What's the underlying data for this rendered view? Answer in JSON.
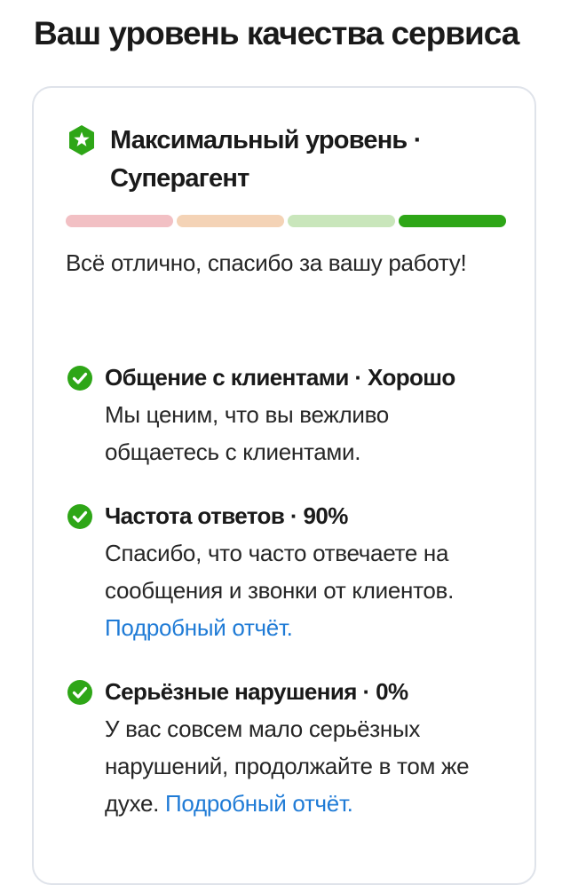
{
  "header": {
    "title": "Ваш уровень качества сервиса"
  },
  "level": {
    "icon": "star-badge-icon",
    "title": "Максимальный уровень · Суперагент",
    "current_step": 4,
    "total_steps": 4,
    "segment_colors": [
      "#f2c0c4",
      "#f4d3b6",
      "#c9e6bb",
      "#2ea617"
    ],
    "summary": "Всё отлично, спасибо за вашу работу!"
  },
  "colors": {
    "accent_green": "#2ea617",
    "link_blue": "#1f7bd6"
  },
  "metrics": [
    {
      "icon": "check-circle-icon",
      "title": "Общение с клиентами · Хорошо",
      "description": "Мы ценим, что вы вежливо общаетесь с клиентами.",
      "link": ""
    },
    {
      "icon": "check-circle-icon",
      "title": "Частота ответов · 90%",
      "description": "Спасибо, что часто отвечаете на сообщения и звонки от клиентов. ",
      "link": "Подробный отчёт."
    },
    {
      "icon": "check-circle-icon",
      "title": "Серьёзные нарушения · 0%",
      "description": "У вас совсем мало серьёзных нарушений, продолжайте в том же духе. ",
      "link": "Подробный отчёт."
    }
  ]
}
